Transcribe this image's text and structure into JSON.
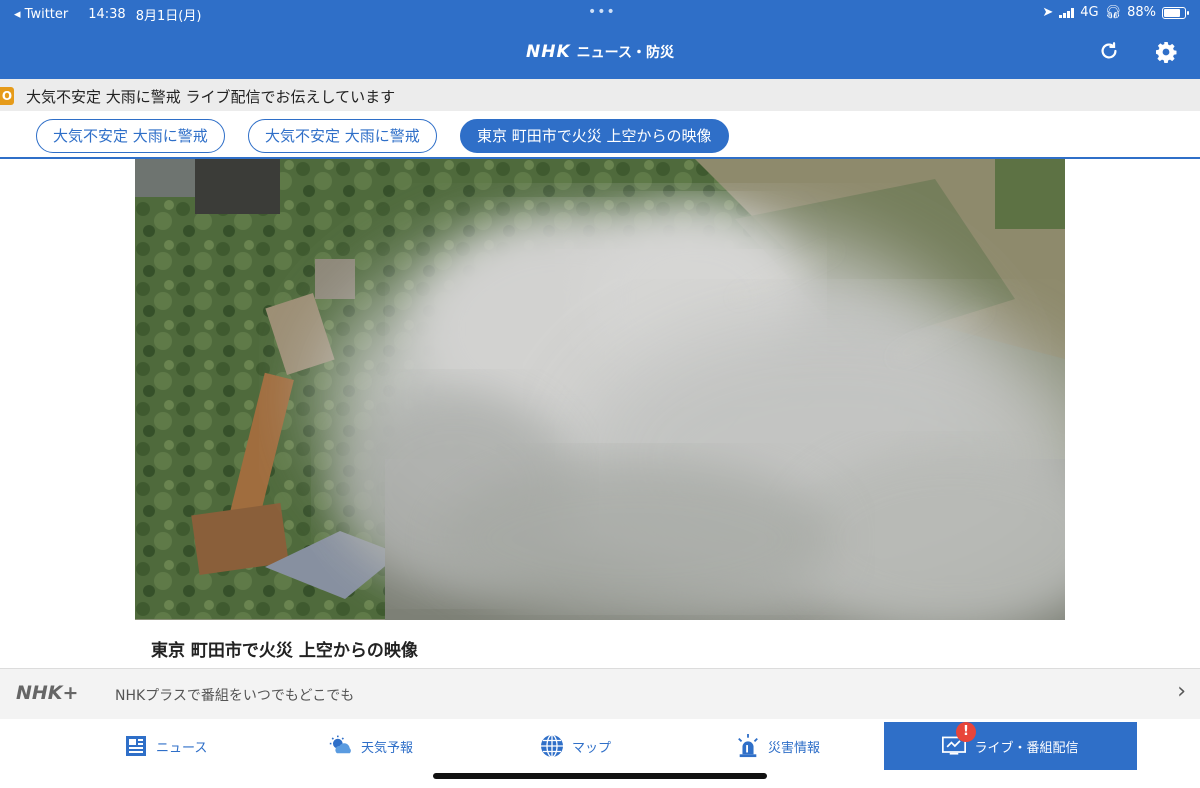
{
  "status_bar": {
    "back_app": "◂ Twitter",
    "time": "14:38",
    "date": "8月1日(月)",
    "network": "4G",
    "battery": "88%"
  },
  "header": {
    "logo": "NHK",
    "title": "ニュース・防災",
    "refresh_icon": "refresh-icon",
    "settings_icon": "gear-icon"
  },
  "alert": {
    "badge": "O",
    "text": "大気不安定 大雨に警戒 ライブ配信でお伝えしています"
  },
  "topics": [
    {
      "label": "大気不安定 大雨に警戒",
      "active": false
    },
    {
      "label": "大気不安定 大雨に警戒",
      "active": false
    },
    {
      "label": "東京 町田市で火災 上空からの映像",
      "active": true
    }
  ],
  "video": {
    "caption": "東京 町田市で火災 上空からの映像"
  },
  "plus_bar": {
    "logo": "NHK+",
    "text": "NHKプラスで番組をいつでもどこでも",
    "chevron": "›"
  },
  "tabs": [
    {
      "label": "ニュース",
      "icon": "news-icon"
    },
    {
      "label": "天気予報",
      "icon": "weather-icon"
    },
    {
      "label": "マップ",
      "icon": "globe-icon"
    },
    {
      "label": "災害情報",
      "icon": "alarm-light-icon"
    },
    {
      "label": "ライブ・番組配信",
      "icon": "live-tv-icon",
      "badge": "!"
    }
  ],
  "colors": {
    "brand": "#2f6fc8",
    "alert_badge": "#e69b1a",
    "notification": "#e8453a"
  }
}
